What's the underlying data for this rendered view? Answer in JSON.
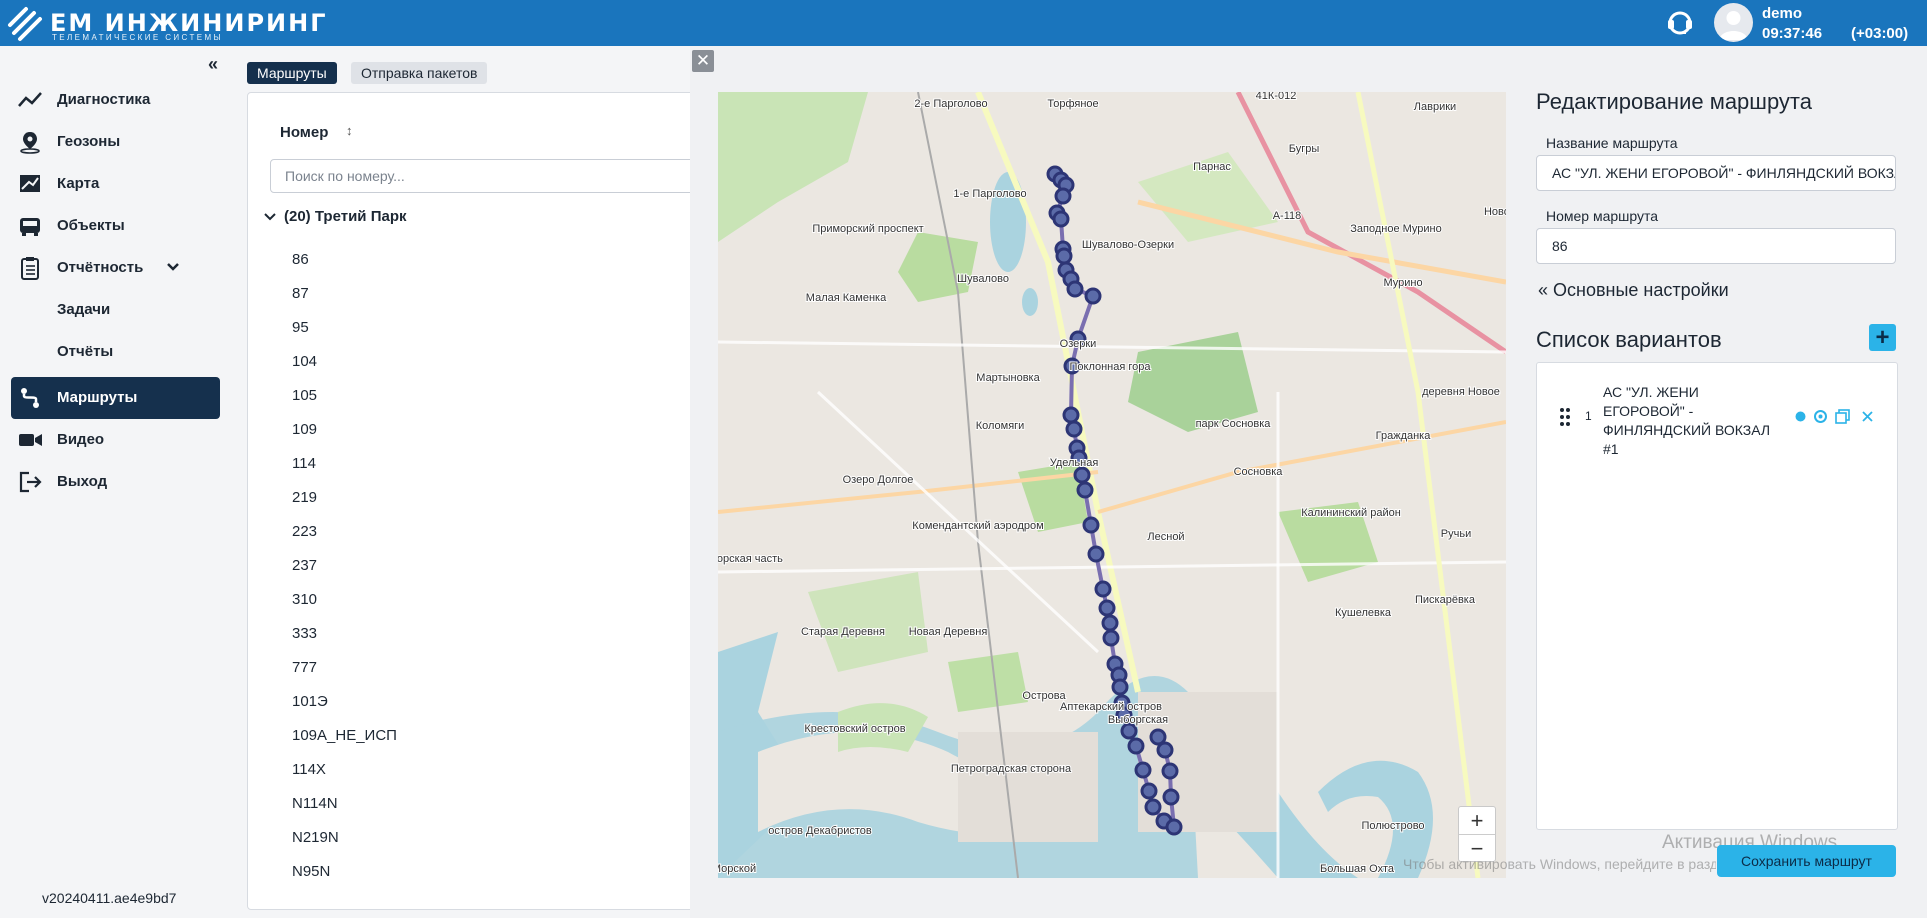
{
  "header": {
    "logo_title": "ЕМ ИНЖИНИРИНГ",
    "logo_subtitle": "ТЕЛЕМАТИЧЕСКИЕ СИСТЕМЫ",
    "username": "demo",
    "time": "09:37:46",
    "timezone": "(+03:00)",
    "brand_color": "#1a75bd"
  },
  "sidebar": {
    "collapse_label": "«",
    "items": [
      {
        "label": "Диагностика",
        "icon": "chart-line-icon"
      },
      {
        "label": "Геозоны",
        "icon": "map-pin-icon"
      },
      {
        "label": "Карта",
        "icon": "map-icon"
      },
      {
        "label": "Объекты",
        "icon": "bus-icon"
      },
      {
        "label": "Отчётность",
        "icon": "clipboard-icon"
      },
      {
        "label": "Задачи",
        "icon": ""
      },
      {
        "label": "Отчёты",
        "icon": ""
      },
      {
        "label": "Маршруты",
        "icon": "route-icon",
        "active": true
      },
      {
        "label": "Видео",
        "icon": "video-icon"
      },
      {
        "label": "Выход",
        "icon": "logout-icon"
      }
    ],
    "version": "v20240411.ae4e9bd7",
    "active_color": "#15304d"
  },
  "routes": {
    "tabs": [
      {
        "label": "Маршруты",
        "active": true
      },
      {
        "label": "Отправка пакетов",
        "active": false
      }
    ],
    "column_header": "Номер",
    "search_placeholder": "Поиск по номеру...",
    "group": "(20) Третий Парк",
    "items": [
      "86",
      "87",
      "95",
      "104",
      "105",
      "109",
      "114",
      "219",
      "223",
      "237",
      "310",
      "333",
      "777",
      "101Э",
      "109А_НЕ_ИСП",
      "114Х",
      "N114N",
      "N219N",
      "N95N"
    ]
  },
  "map": {
    "labels": [
      "2-е Парголово",
      "Торфяное",
      "41К-012",
      "Лаврики",
      "Парнас",
      "Бугры",
      "1-е Парголово",
      "А-118",
      "Шувалово-Озерки",
      "Заподное Мурино",
      "Новое",
      "Шувалово",
      "Малая Каменка",
      "Мурино",
      "Озерки",
      "Поклонная гора",
      "Мартыновка",
      "деревня Новое",
      "Коломяги",
      "парк Сосновка",
      "Гражданка",
      "Удельная",
      "Сосновка",
      "Озеро Долгое",
      "Калининский район",
      "Комендантский аэродром",
      "Ручьи",
      "Лесной",
      "Приморская часть",
      "Пискарёвка",
      "Кушелевка",
      "Старая Деревня",
      "Новая Деревня",
      "Острова",
      "Аптекарский остров",
      "Выборгская",
      "Крестовский остров",
      "Полюстрово",
      "Петроградская сторона",
      "остров Декабристов",
      "Морской",
      "Большая Охта",
      "Приморский проспект"
    ],
    "zoom_in": "+",
    "zoom_out": "−",
    "route_color": "#2d3575"
  },
  "edit": {
    "title": "Редактирование маршрута",
    "name_label": "Название маршрута",
    "name_value": "АС \"УЛ. ЖЕНИ ЕГОРОВОЙ\" - ФИНЛЯНДСКИЙ ВОКЗАЛ",
    "number_label": "Номер маршрута",
    "number_value": "86",
    "basic_settings": "« Основные настройки",
    "variants_title": "Список вариантов",
    "add_label": "+",
    "variants": [
      {
        "index": "1",
        "name": "АС \"УЛ. ЖЕНИ ЕГОРОВОЙ\" - ФИНЛЯНДСКИЙ ВОКЗАЛ #1"
      }
    ],
    "save_label": "Сохранить маршрут",
    "accent_color": "#2bb3e8"
  },
  "watermark": {
    "line1": "Активация Windows",
    "line2": "Чтобы активировать Windows, перейдите в раздел «Параметры»"
  }
}
